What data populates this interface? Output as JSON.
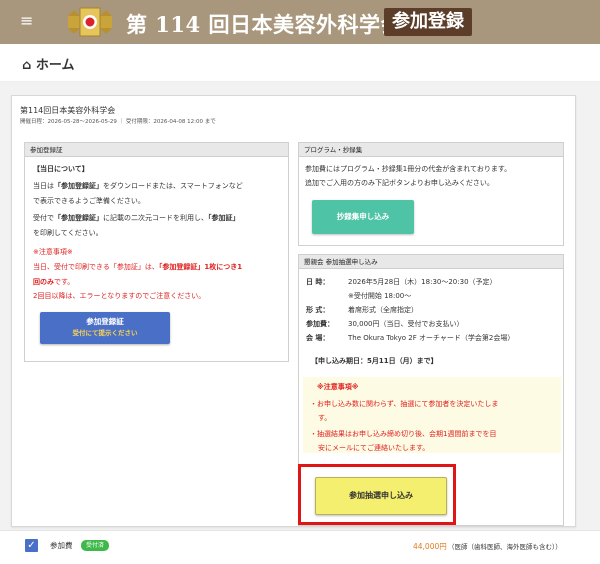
{
  "header": {
    "title": "第 114 回日本美容外科学会",
    "badge": "参加登録",
    "menu_icon": "hamburger-menu-icon",
    "logo_icon": "society-emblem-icon"
  },
  "nav": {
    "home_icon": "home-icon",
    "home_label": "ホーム"
  },
  "event_card": {
    "title": "第114回日本美容外科学会",
    "dates": "開催日程：2026-05-28〜2026-05-29 ｜ 受付期限：2026-04-08 12:00 まで"
  },
  "left_panel": {
    "header": "参加登録証",
    "day_heading": "【当日について】",
    "p1_prefix": "当日は",
    "p1_bold": "「参加登録証」",
    "p1_suffix": "をダウンロードまたは、スマートフォンなど",
    "p1_line2": "で表示できるようご準備ください。",
    "p2_prefix": "受付で",
    "p2_bold": "「参加登録証」",
    "p2_middle": "に記載の二次元コードを利用し、",
    "p2_bold2": "「参加証」",
    "p2_line2": "を印刷してください。",
    "notice_heading": "※注意事項※",
    "notice_line1_a": "当日、受付で印刷できる「参加証」は、",
    "notice_line1_b": "「参加登録証」1枚につき1",
    "notice_line2_bold": "回のみ",
    "notice_line2_rest": "です。",
    "notice_line3": "2回目以降は、エラーとなりますのでご注意ください。",
    "button_line1": "参加登録証",
    "button_line2": "受付にて提示ください"
  },
  "program_panel": {
    "header": "プログラム・抄録集",
    "text_line1": "参加費にはプログラム・抄録集1冊分の代金が含まれております。",
    "text_line2": "追加でご入用の方のみ下記ボタンよりお申し込みください。",
    "button": "抄録集申し込み"
  },
  "lottery_panel": {
    "header": "懇親会 参加抽選申し込み",
    "rows": [
      {
        "label": "日 時：",
        "value": "2026年5月28日（木）18:30〜20:30（予定）"
      },
      {
        "label": "",
        "value": "※受付開始 18:00〜"
      },
      {
        "label": "形 式：",
        "value": "着席形式（全席指定）"
      },
      {
        "label": "参加費：",
        "value": "30,000円（当日、受付でお支払い）"
      },
      {
        "label": "会 場：",
        "value": "The Okura Tokyo 2F オーチャード（学会第2会場）"
      }
    ],
    "deadline": "【申し込み期日：5月11日（月）まで】",
    "notice_heading": "※注意事項※",
    "notice_items": [
      {
        "line1": "・お申し込み数に関わらず、抽選にて参加者を決定いたしま",
        "line2": "す。"
      },
      {
        "line1": "・抽選結果はお申し込み締め切り後、会期1週間前までを目",
        "line2": "安にメールにてご連絡いたします。"
      }
    ],
    "button": "参加抽選申し込み"
  },
  "fee_row": {
    "label": "参加費",
    "badge": "受付済",
    "amount": "44,000円",
    "note": "（医師（歯科医師、海外医師も含む））"
  },
  "colors": {
    "header_bg": "#a8977d",
    "badge_bg": "#5c3d2a",
    "blue_button": "#4a6fc7",
    "teal_button": "#4ec3a5",
    "yellow_button": "#f4ef6e",
    "highlight_frame": "#e01616",
    "notice_red": "#e02020",
    "amount_orange": "#e07b20",
    "badge_green": "#3fb84a"
  }
}
